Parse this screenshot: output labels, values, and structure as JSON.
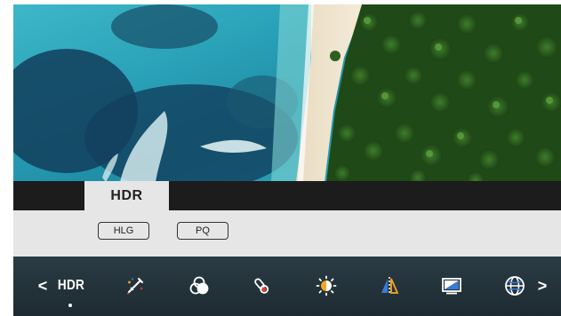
{
  "hdr_tab": {
    "label": "HDR"
  },
  "hdr_options": [
    {
      "label": "HLG"
    },
    {
      "label": "PQ"
    }
  ],
  "toolbar": {
    "prev_label": "<",
    "current_label": "HDR",
    "next_label": ">",
    "icons": [
      "magic-wand-icon",
      "color-circles-icon",
      "color-temperature-icon",
      "brightness-icon",
      "mirror-flip-icon",
      "display-icon",
      "globe-icon"
    ]
  },
  "colors": {
    "tab_bar": "#1c1c1c",
    "option_bar": "#e6e6e6",
    "toolbar": "#23323a",
    "accent_orange": "#f5a623",
    "accent_blue": "#3a7bd5",
    "accent_red": "#e53935"
  }
}
